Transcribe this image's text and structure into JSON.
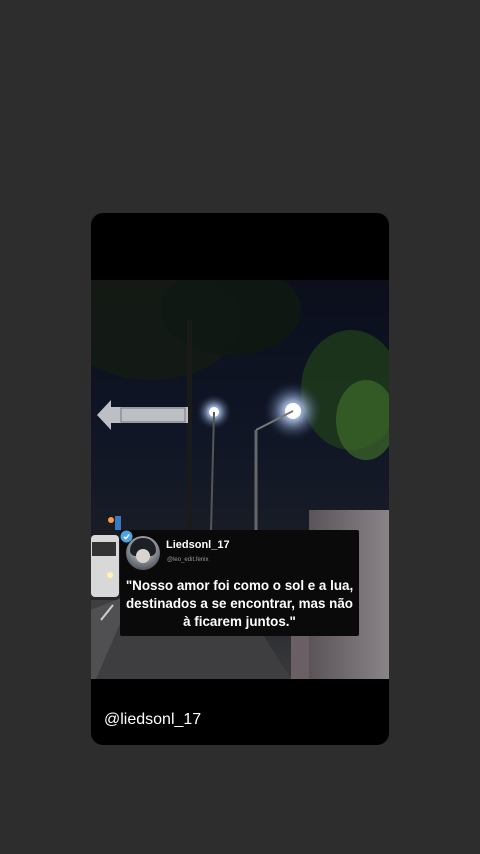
{
  "story": {
    "tweet": {
      "username": "Liedsonl_17",
      "handle": "@leo_edit.fenix",
      "quote": "\"Nosso amor foi como o sol e a lua,\ndestinados a se encontrar, mas não\nà ficarem juntos.\"",
      "verified_icon": "verified-badge-icon",
      "verified_color": "#4fa3e0"
    },
    "footer_handle": "@liedsonl_17"
  },
  "colors": {
    "page_background": "#2d2d2d",
    "card_background": "#000000"
  }
}
